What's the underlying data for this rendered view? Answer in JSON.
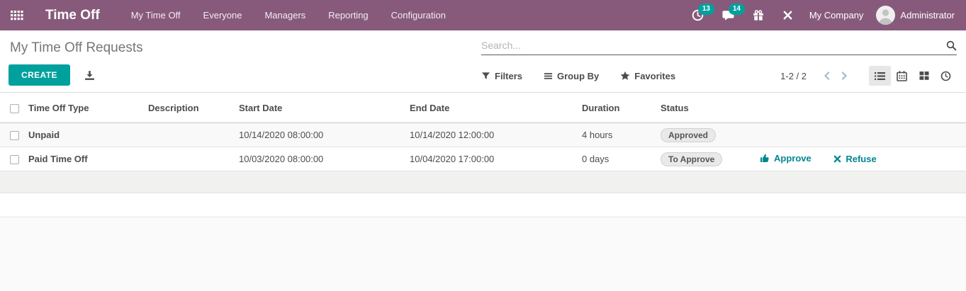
{
  "navbar": {
    "app_title": "Time Off",
    "menu": [
      "My Time Off",
      "Everyone",
      "Managers",
      "Reporting",
      "Configuration"
    ],
    "activity_count": "13",
    "message_count": "14",
    "company": "My Company",
    "user": "Administrator"
  },
  "control_panel": {
    "breadcrumb": "My Time Off Requests",
    "create_label": "CREATE",
    "search_placeholder": "Search...",
    "filters_label": "Filters",
    "group_by_label": "Group By",
    "favorites_label": "Favorites",
    "pager": "1-2 / 2"
  },
  "table": {
    "columns": {
      "type": "Time Off Type",
      "description": "Description",
      "start": "Start Date",
      "end": "End Date",
      "duration": "Duration",
      "status": "Status"
    },
    "rows": [
      {
        "type": "Unpaid",
        "description": "",
        "start": "10/14/2020 08:00:00",
        "end": "10/14/2020 12:00:00",
        "duration": "4 hours",
        "status": "Approved"
      },
      {
        "type": "Paid Time Off",
        "description": "",
        "start": "10/03/2020 08:00:00",
        "end": "10/04/2020 17:00:00",
        "duration": "0 days",
        "status": "To Approve"
      }
    ],
    "approve_label": "Approve",
    "refuse_label": "Refuse"
  },
  "icons": {
    "apps": "grid-4x3",
    "activity": "clock",
    "messages": "chat-bubble",
    "gift": "gift-box",
    "tools": "crossed-tools",
    "search": "magnifier",
    "filters": "funnel",
    "group_by": "bars",
    "favorites": "star",
    "download": "download-tray",
    "view_list": "list",
    "view_calendar": "calendar",
    "view_kanban": "grid-2x2",
    "view_clock": "clock",
    "approve": "thumbs-up",
    "refuse": "x-mark",
    "prev": "chevron-left",
    "next": "chevron-right"
  },
  "colors": {
    "navbar_bg": "#875A7B",
    "primary_teal": "#00A09D",
    "action_teal": "#018790",
    "text_dark": "#4c4c4c",
    "badge_bg": "#e9e9e9",
    "row_stripe": "#f9f9f9",
    "trailing_band": "#f1f1ef"
  }
}
